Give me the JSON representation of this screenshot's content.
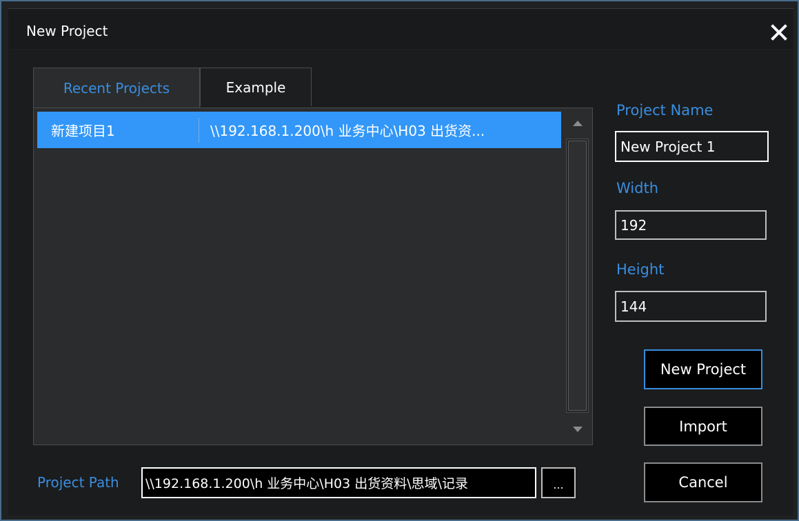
{
  "window": {
    "title": "New Project",
    "close_icon": "close-icon"
  },
  "tabs": [
    {
      "label": "Recent Projects",
      "active": true
    },
    {
      "label": "Example",
      "active": false
    }
  ],
  "recent_list": {
    "rows": [
      {
        "name": "新建项目1",
        "path": "\\\\192.168.1.200\\h 业务中心\\H03 出货资...",
        "selected": true
      }
    ]
  },
  "scrollbar": {
    "up_icon": "triangle-up-icon",
    "down_icon": "triangle-down-icon"
  },
  "form": {
    "project_name_label": "Project Name",
    "project_name_value": "New Project 1",
    "width_label": "Width",
    "width_value": "192",
    "height_label": "Height",
    "height_value": "144"
  },
  "buttons": {
    "new_project": "New Project",
    "import": "Import",
    "cancel": "Cancel"
  },
  "path": {
    "label": "Project Path",
    "value": "\\\\192.168.1.200\\h 业务中心\\H03 出货资料\\思域\\记录",
    "browse_label": "..."
  },
  "colors": {
    "accent": "#3a8ee0",
    "selection": "#3297f8",
    "background": "#1b1c1d"
  }
}
